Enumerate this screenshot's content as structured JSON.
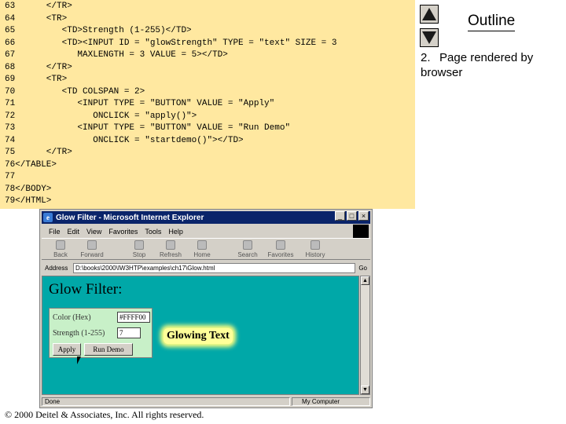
{
  "code_lines": [
    {
      "num": "63",
      "text": "      </TR>"
    },
    {
      "num": "64",
      "text": "      <TR>"
    },
    {
      "num": "65",
      "text": "         <TD>Strength (1-255)</TD>"
    },
    {
      "num": "66",
      "text": "         <TD><INPUT ID = \"glowStrength\" TYPE = \"text\" SIZE = 3"
    },
    {
      "num": "67",
      "text": "            MAXLENGTH = 3 VALUE = 5></TD>"
    },
    {
      "num": "68",
      "text": "      </TR>"
    },
    {
      "num": "69",
      "text": "      <TR>"
    },
    {
      "num": "70",
      "text": "         <TD COLSPAN = 2>"
    },
    {
      "num": "71",
      "text": "            <INPUT TYPE = \"BUTTON\" VALUE = \"Apply\""
    },
    {
      "num": "72",
      "text": "               ONCLICK = \"apply()\">"
    },
    {
      "num": "73",
      "text": "            <INPUT TYPE = \"BUTTON\" VALUE = \"Run Demo\""
    },
    {
      "num": "74",
      "text": "               ONCLICK = \"startdemo()\"></TD>"
    },
    {
      "num": "75",
      "text": "      </TR>"
    },
    {
      "num": "76",
      "text": "</TABLE>"
    },
    {
      "num": "77",
      "text": ""
    },
    {
      "num": "78",
      "text": "</BODY>"
    },
    {
      "num": "79",
      "text": "</HTML>"
    }
  ],
  "outline": {
    "title": "Outline",
    "item_number": "2.",
    "item_text": "Page rendered by browser"
  },
  "browser": {
    "window_title": "Glow Filter - Microsoft Internet Explorer",
    "menu": [
      "File",
      "Edit",
      "View",
      "Favorites",
      "Tools",
      "Help"
    ],
    "toolbar": [
      "Back",
      "Forward",
      "Stop",
      "Refresh",
      "Home",
      "Search",
      "Favorites",
      "History"
    ],
    "address_label": "Address",
    "address_value": "D:\\books\\2000\\IW3HTP\\examples\\ch17\\Glow.html",
    "go_label": "Go",
    "status_left": "Done",
    "status_right": "My Computer"
  },
  "page": {
    "heading": "Glow Filter:",
    "color_label": "Color (Hex)",
    "color_value": "#FFFF00",
    "strength_label": "Strength (1-255)",
    "strength_value": "7",
    "apply_label": "Apply",
    "run_demo_label": "Run Demo",
    "glowing_text": "Glowing Text"
  },
  "footer": {
    "copyright": "© 2000 Deitel & Associates, Inc.  All rights reserved."
  },
  "colors": {
    "code_background": "#ffe8a0",
    "content_background": "#00a8a8",
    "form_background": "#c8f0c8",
    "glow_color": "#ffff80"
  }
}
